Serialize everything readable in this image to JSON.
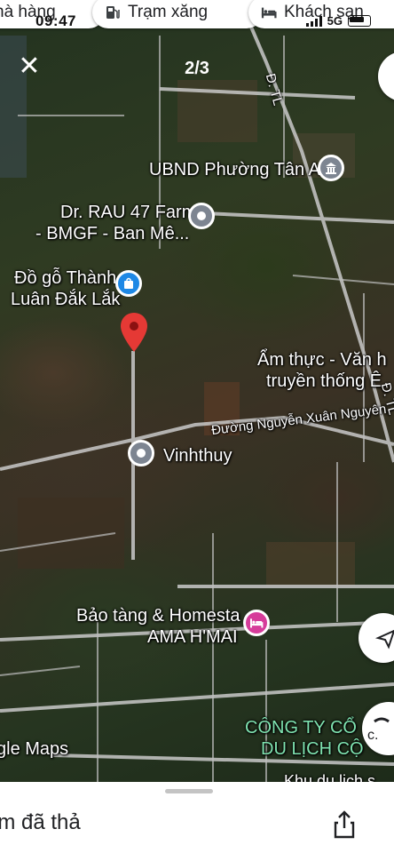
{
  "status_bar": {
    "time": "09:47",
    "network": "5G"
  },
  "chips": {
    "restaurant": "hà hàng",
    "gas": "Trạm xăng",
    "hotel": "Khách sạn"
  },
  "viewer": {
    "counter": "2/3"
  },
  "map": {
    "places": {
      "ubnd": "UBND Phường Tân A",
      "farm_line1": "Dr. RAU 47 Farm",
      "farm_line2": "- BMGF - Ban Mê...",
      "wood_line1": "Đồ gỗ Thành",
      "wood_line2": "Luân Đắk Lắk",
      "food_line1": "Ẩm thực - Văn h",
      "food_line2": "truyền thống Ê",
      "vinhthuy": "Vinhthuy",
      "museum_line1": "Bảo tàng & Homesta",
      "museum_line2": "AMA H'MAI",
      "company_line1": "CÔNG TY CỔ",
      "company_line2": "DU LỊCH CỘ",
      "khu": "Khu du lịch s"
    },
    "roads": {
      "nguyen_xuan_nguyen": "Đường Nguyễn Xuân Nguyên",
      "dt_top": "Đ. TL",
      "dt_right": "Đ. TL"
    },
    "brand": "gle Maps"
  },
  "sheet": {
    "title": "im đã thả"
  },
  "icons": {
    "close": "close-icon",
    "share": "share-icon",
    "pin": "red-pin-icon"
  }
}
